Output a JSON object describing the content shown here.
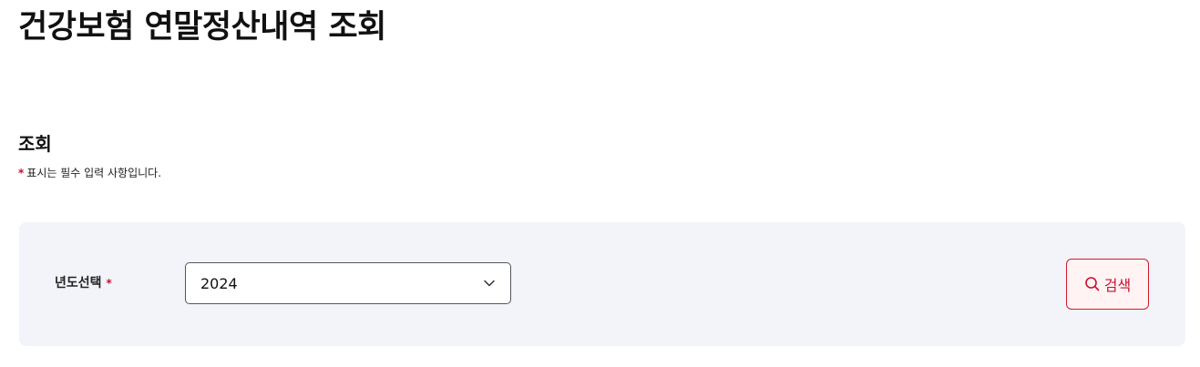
{
  "page": {
    "title": "건강보험 연말정산내역 조회"
  },
  "section": {
    "title": "조회",
    "required_star": "*",
    "required_note": "표시는 필수 입력 사항입니다."
  },
  "search_form": {
    "year_label": "년도선택",
    "year_required_star": "*",
    "year_value": "2024",
    "search_button_label": "검색"
  },
  "colors": {
    "accent": "#c8102e",
    "panel_background": "#f3f4f9",
    "button_background": "#fff3f4"
  },
  "icons": {
    "select": "chevron-down-icon",
    "button": "search-icon"
  }
}
